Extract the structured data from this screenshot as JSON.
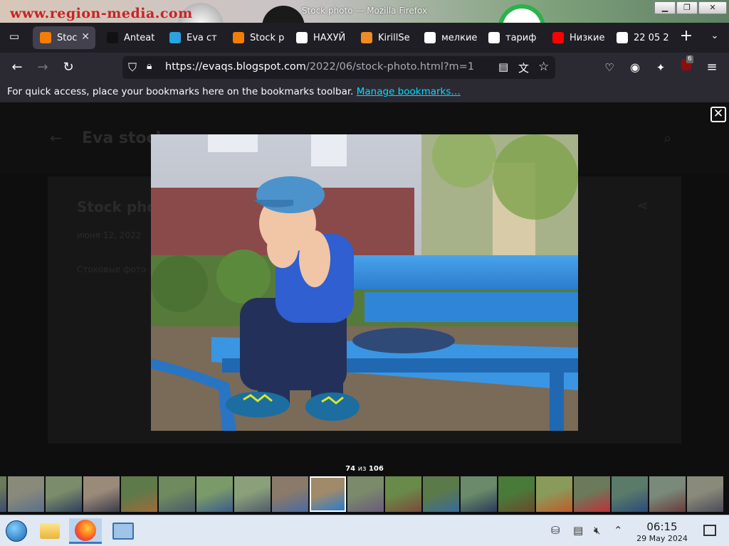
{
  "window": {
    "title": "Stock photo — Mozilla Firefox",
    "wallpaper_text": "www.region-media.com"
  },
  "tabs": [
    {
      "label": "Stoc",
      "icon": "blogger-icon",
      "color": "#f57d00",
      "active": true
    },
    {
      "label": "Anteat",
      "icon": "dark-favicon-icon",
      "color": "#111111",
      "active": false
    },
    {
      "label": "Eva ст",
      "icon": "telegram-icon",
      "color": "#2aa3e0",
      "active": false
    },
    {
      "label": "Stock p",
      "icon": "blogger-icon",
      "color": "#f57d00",
      "active": false
    },
    {
      "label": "НАХУЙ",
      "icon": "dark-square-icon",
      "color": "#ffffff",
      "active": false
    },
    {
      "label": "KirillSe",
      "icon": "orange-ball-icon",
      "color": "#f08a24",
      "active": false
    },
    {
      "label": "мелкие",
      "icon": "google-icon",
      "color": "#ffffff",
      "active": false
    },
    {
      "label": "тариф",
      "icon": "google-icon",
      "color": "#ffffff",
      "active": false
    },
    {
      "label": "Низкие",
      "icon": "youtube-icon",
      "color": "#ff0000",
      "active": false
    },
    {
      "label": "22 05 2",
      "icon": "google-color-icon",
      "color": "#ffffff",
      "active": false
    }
  ],
  "navbar": {
    "url_main": "https://evaqs.blogspot.com",
    "url_path": "/2022/06/stock-photo.html?m=1",
    "extension_badge": "6"
  },
  "bookmarks_bar": {
    "message": "For quick access, place your bookmarks here on the bookmarks toolbar.",
    "link": "Manage bookmarks…"
  },
  "blog": {
    "title": "Eva stock",
    "post_title": "Stock phot",
    "meta": "июня 12, 2022",
    "snippet": "Стоковые фото"
  },
  "lightbox": {
    "current": "74",
    "separator": "из",
    "total": "106",
    "photo_alt": "Boy in blue cap sitting on a blue bench"
  },
  "taskbar": {
    "time": "06:15",
    "date": "29 May 2024"
  }
}
